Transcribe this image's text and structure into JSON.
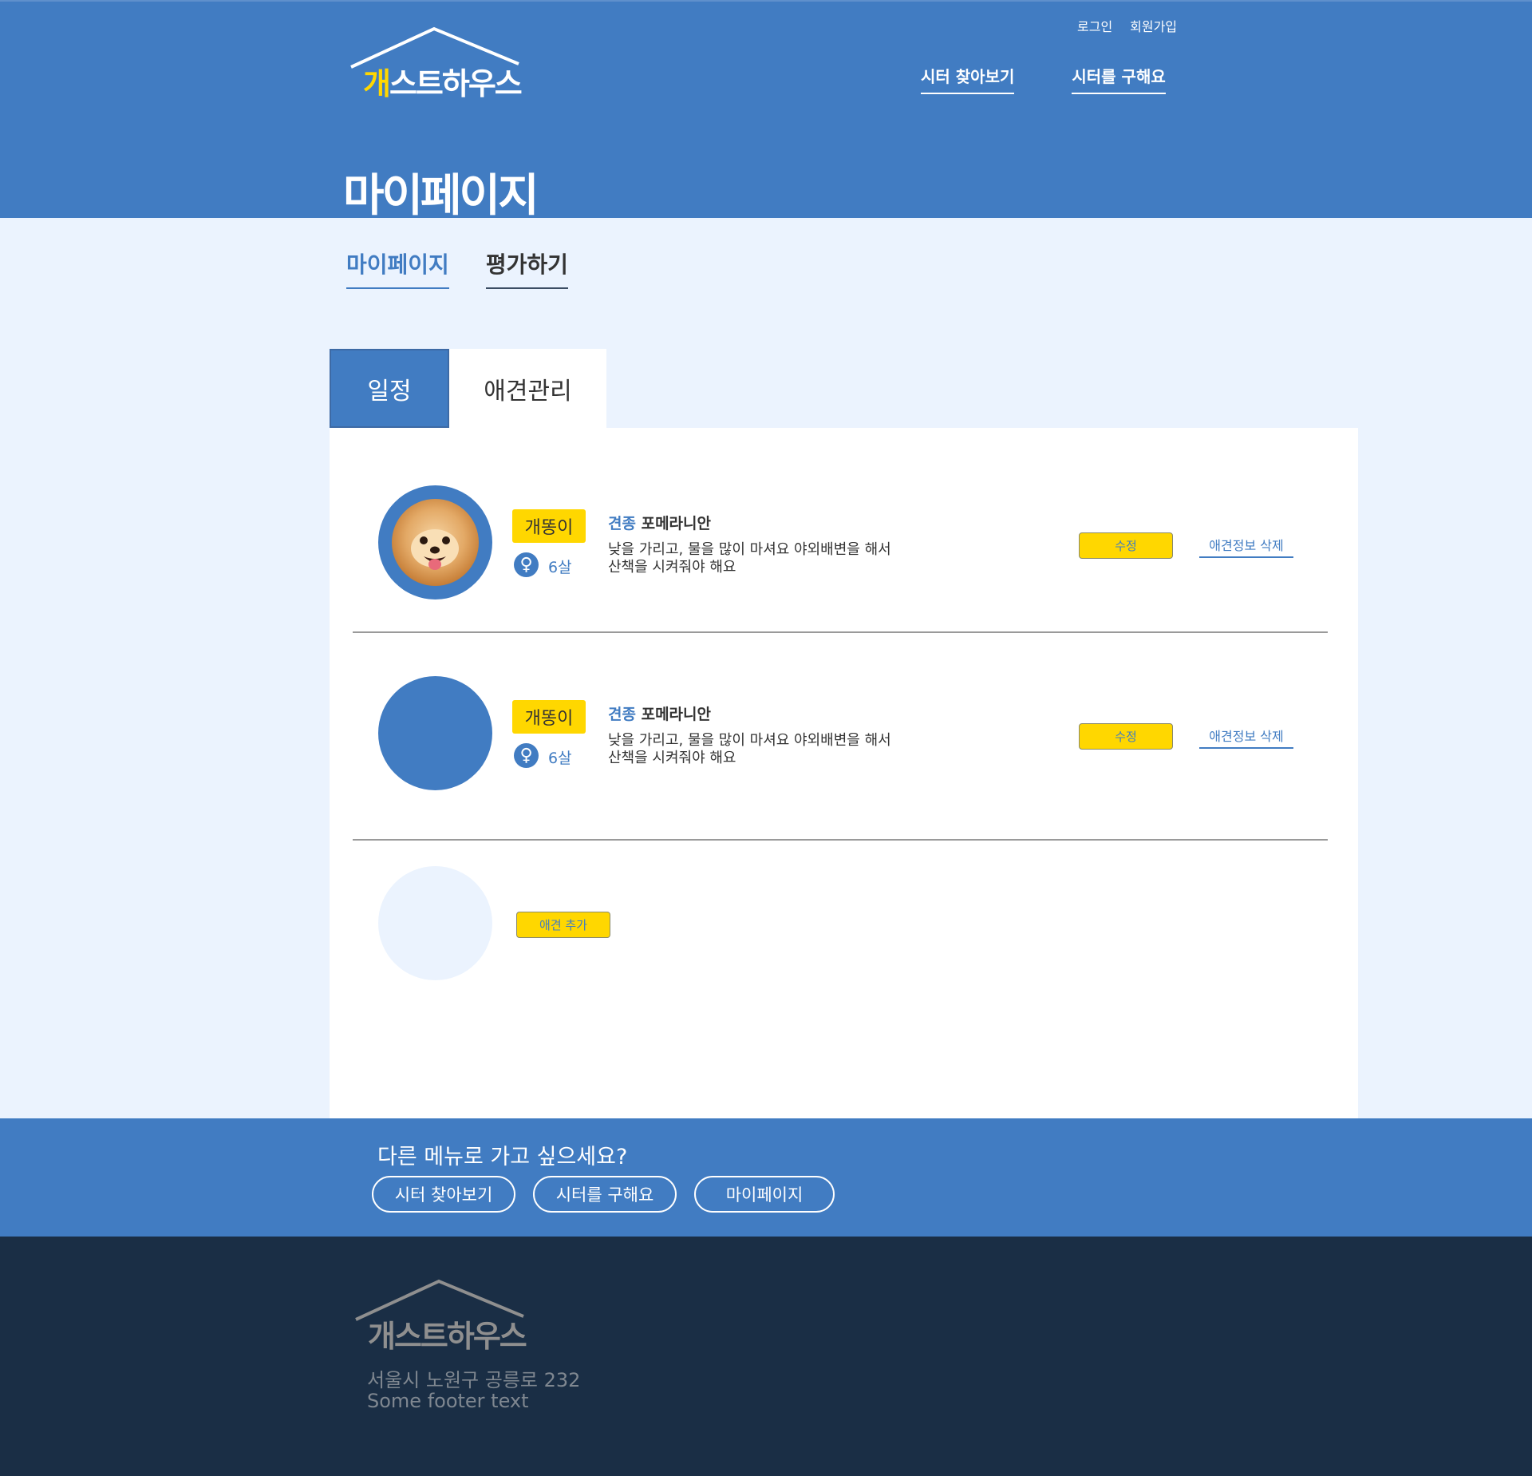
{
  "brand": {
    "logo_accent": "개",
    "logo_rest": "스트하우스",
    "primary_color": "#417cc2",
    "highlight_color": "#ffd700",
    "footer_color": "#1a2e45"
  },
  "header": {
    "auth_links": [
      "로그인",
      "회원가입"
    ],
    "nav": [
      "시터 찾아보기",
      "시터를 구해요"
    ],
    "page_title": "마이페이지"
  },
  "sub_nav": {
    "items": [
      "마이페이지",
      "평가하기"
    ],
    "active": "마이페이지"
  },
  "tabs": {
    "items": [
      "일정",
      "애견관리"
    ],
    "selected": "일정"
  },
  "dogs": [
    {
      "name": "개똥이",
      "gender_icon": "female-icon",
      "gender_symbol": "♀",
      "age": "6살",
      "breed_label": "견종",
      "breed": "포메라니안",
      "description": "낮을 가리고, 물을 많이 마셔요 야외배변을 해서 산책을 시켜줘야 해요",
      "photo": "pomeranian-photo",
      "edit_label": "수정",
      "delete_label": "애견정보 삭제"
    },
    {
      "name": "개똥이",
      "gender_icon": "female-icon",
      "gender_symbol": "♀",
      "age": "6살",
      "breed_label": "견종",
      "breed": "포메라니안",
      "description": "낮을 가리고, 물을 많이 마셔요 야외배변을 해서 산책을 시켜줘야 해요",
      "photo": "placeholder-avatar",
      "edit_label": "수정",
      "delete_label": "애견정보 삭제"
    }
  ],
  "add_dog_label": "애견 추가",
  "menu_band": {
    "title": "다른 메뉴로 가고 싶으세요?",
    "buttons": [
      "시터 찾아보기",
      "시터를 구해요",
      "마이페이지"
    ]
  },
  "footer": {
    "logo_text": "개스트하우스",
    "address": "서울시 노원구 공릉로 232",
    "note": "Some footer text"
  }
}
